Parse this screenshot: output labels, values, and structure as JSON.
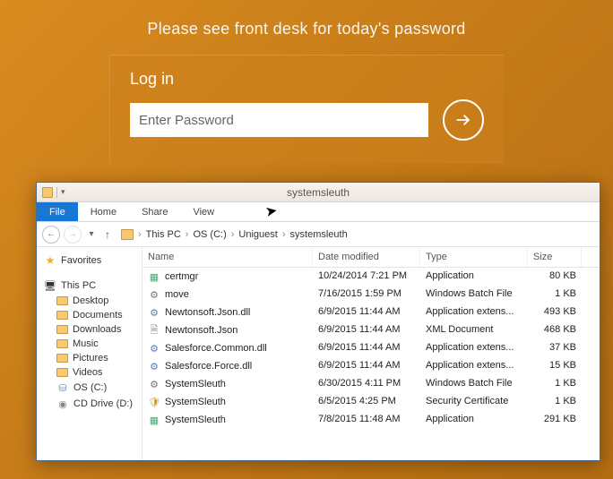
{
  "kiosk": {
    "message": "Please see front desk for today's password",
    "login_label": "Log in",
    "password_placeholder": "Enter Password"
  },
  "explorer": {
    "title": "systemsleuth",
    "tabs": {
      "file": "File",
      "home": "Home",
      "share": "Share",
      "view": "View"
    },
    "breadcrumb": [
      "This PC",
      "OS (C:)",
      "Uniguest",
      "systemsleuth"
    ],
    "nav": {
      "favorites": "Favorites",
      "this_pc": "This PC",
      "folders": [
        "Desktop",
        "Documents",
        "Downloads",
        "Music",
        "Pictures",
        "Videos"
      ],
      "drives": [
        "OS (C:)",
        "CD Drive (D:)"
      ]
    },
    "columns": {
      "name": "Name",
      "modified": "Date modified",
      "type": "Type",
      "size": "Size"
    },
    "files": [
      {
        "name": "certmgr",
        "icon": "app",
        "modified": "10/24/2014 7:21 PM",
        "type": "Application",
        "size": "80 KB"
      },
      {
        "name": "move",
        "icon": "bat",
        "modified": "7/16/2015 1:59 PM",
        "type": "Windows Batch File",
        "size": "1 KB"
      },
      {
        "name": "Newtonsoft.Json.dll",
        "icon": "dll",
        "modified": "6/9/2015 11:44 AM",
        "type": "Application extens...",
        "size": "493 KB"
      },
      {
        "name": "Newtonsoft.Json",
        "icon": "json",
        "modified": "6/9/2015 11:44 AM",
        "type": "XML Document",
        "size": "468 KB"
      },
      {
        "name": "Salesforce.Common.dll",
        "icon": "dll",
        "modified": "6/9/2015 11:44 AM",
        "type": "Application extens...",
        "size": "37 KB"
      },
      {
        "name": "Salesforce.Force.dll",
        "icon": "dll",
        "modified": "6/9/2015 11:44 AM",
        "type": "Application extens...",
        "size": "15 KB"
      },
      {
        "name": "SystemSleuth",
        "icon": "bat",
        "modified": "6/30/2015 4:11 PM",
        "type": "Windows Batch File",
        "size": "1 KB"
      },
      {
        "name": "SystemSleuth",
        "icon": "cert",
        "modified": "6/5/2015 4:25 PM",
        "type": "Security Certificate",
        "size": "1 KB"
      },
      {
        "name": "SystemSleuth",
        "icon": "app",
        "modified": "7/8/2015 11:48 AM",
        "type": "Application",
        "size": "291 KB"
      }
    ]
  }
}
